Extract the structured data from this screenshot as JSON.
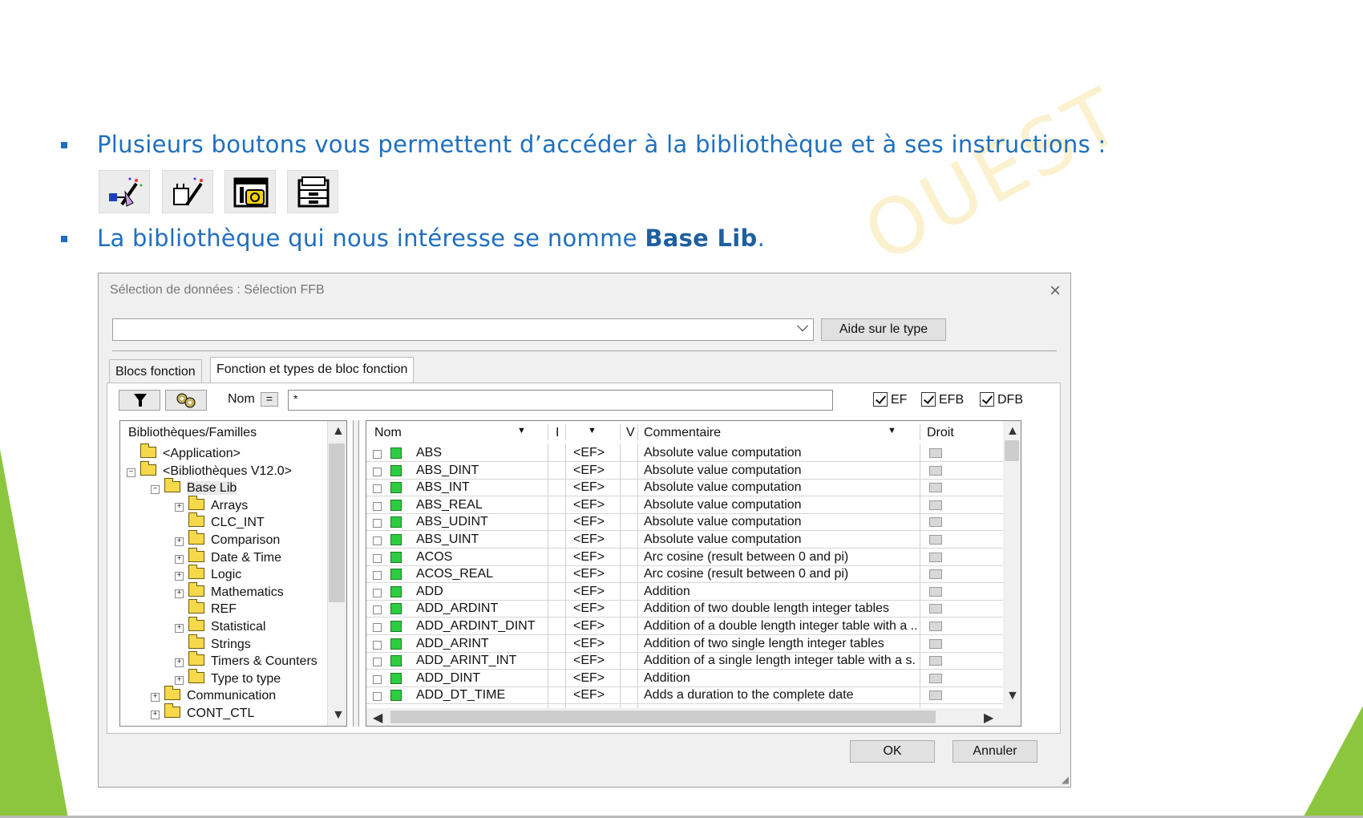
{
  "slide": {
    "bullet1": "Plusieurs boutons vous permettent d’accéder à la bibliothèque et à ses instructions :",
    "bullet2_pre": "La bibliothèque qui nous intéresse se nomme ",
    "bullet2_bold": "Base Lib",
    "bullet2_post": ".",
    "watermark": "OUEST",
    "toolbar_icons": [
      "ffb-wand-icon",
      "ffb-wand-plug-icon",
      "data-selection-icon",
      "library-browser-icon"
    ]
  },
  "dialog": {
    "title": "Sélection de données : Sélection FFB",
    "close_label": "×",
    "type_combo_value": "",
    "help_button": "Aide sur le type",
    "tabs": [
      {
        "label": "Blocs fonction",
        "active": false
      },
      {
        "label": "Fonction et types de bloc fonction",
        "active": true
      }
    ],
    "filter": {
      "nom_label": "Nom",
      "eq_label": "=",
      "value": "*",
      "checkboxes": [
        {
          "label": "EF",
          "checked": true
        },
        {
          "label": "EFB",
          "checked": true
        },
        {
          "label": "DFB",
          "checked": true
        }
      ]
    },
    "tree": {
      "header": "Bibliothèques/Familles",
      "items": [
        {
          "label": "<Application>",
          "level": 1,
          "expander": ""
        },
        {
          "label": "<Bibliothèques V12.0>",
          "level": 1,
          "expander": "−"
        },
        {
          "label": "Base Lib",
          "level": 2,
          "expander": "−",
          "selected": true
        },
        {
          "label": "Arrays",
          "level": 3,
          "expander": "+"
        },
        {
          "label": "CLC_INT",
          "level": 3,
          "expander": ""
        },
        {
          "label": "Comparison",
          "level": 3,
          "expander": "+"
        },
        {
          "label": "Date & Time",
          "level": 3,
          "expander": "+"
        },
        {
          "label": "Logic",
          "level": 3,
          "expander": "+"
        },
        {
          "label": "Mathematics",
          "level": 3,
          "expander": "+"
        },
        {
          "label": "REF",
          "level": 3,
          "expander": ""
        },
        {
          "label": "Statistical",
          "level": 3,
          "expander": "+"
        },
        {
          "label": "Strings",
          "level": 3,
          "expander": ""
        },
        {
          "label": "Timers & Counters",
          "level": 3,
          "expander": "+"
        },
        {
          "label": "Type to type",
          "level": 3,
          "expander": "+"
        },
        {
          "label": "Communication",
          "level": 2,
          "expander": "+"
        },
        {
          "label": "CONT_CTL",
          "level": 2,
          "expander": "+"
        }
      ]
    },
    "grid": {
      "columns": [
        "Nom",
        "I",
        "",
        "V",
        "Commentaire",
        "Droit"
      ],
      "rows": [
        {
          "name": "ABS",
          "type": "<EF>",
          "comment": "Absolute value computation"
        },
        {
          "name": "ABS_DINT",
          "type": "<EF>",
          "comment": "Absolute value computation"
        },
        {
          "name": "ABS_INT",
          "type": "<EF>",
          "comment": "Absolute value computation"
        },
        {
          "name": "ABS_REAL",
          "type": "<EF>",
          "comment": "Absolute value computation"
        },
        {
          "name": "ABS_UDINT",
          "type": "<EF>",
          "comment": "Absolute value computation"
        },
        {
          "name": "ABS_UINT",
          "type": "<EF>",
          "comment": "Absolute value computation"
        },
        {
          "name": "ACOS",
          "type": "<EF>",
          "comment": "Arc cosine (result between 0 and pi)"
        },
        {
          "name": "ACOS_REAL",
          "type": "<EF>",
          "comment": "Arc cosine (result between 0 and pi)"
        },
        {
          "name": "ADD",
          "type": "<EF>",
          "comment": "Addition"
        },
        {
          "name": "ADD_ARDINT",
          "type": "<EF>",
          "comment": "Addition of two double length integer tables"
        },
        {
          "name": "ADD_ARDINT_DINT",
          "type": "<EF>",
          "comment": "Addition of a double length integer table with a ..."
        },
        {
          "name": "ADD_ARINT",
          "type": "<EF>",
          "comment": "Addition of two single length integer tables"
        },
        {
          "name": "ADD_ARINT_INT",
          "type": "<EF>",
          "comment": "Addition of a single length integer table with a s..."
        },
        {
          "name": "ADD_DINT",
          "type": "<EF>",
          "comment": "Addition"
        },
        {
          "name": "ADD_DT_TIME",
          "type": "<EF>",
          "comment": "Adds a duration to the complete date"
        }
      ]
    },
    "ok_button": "OK",
    "cancel_button": "Annuler"
  }
}
